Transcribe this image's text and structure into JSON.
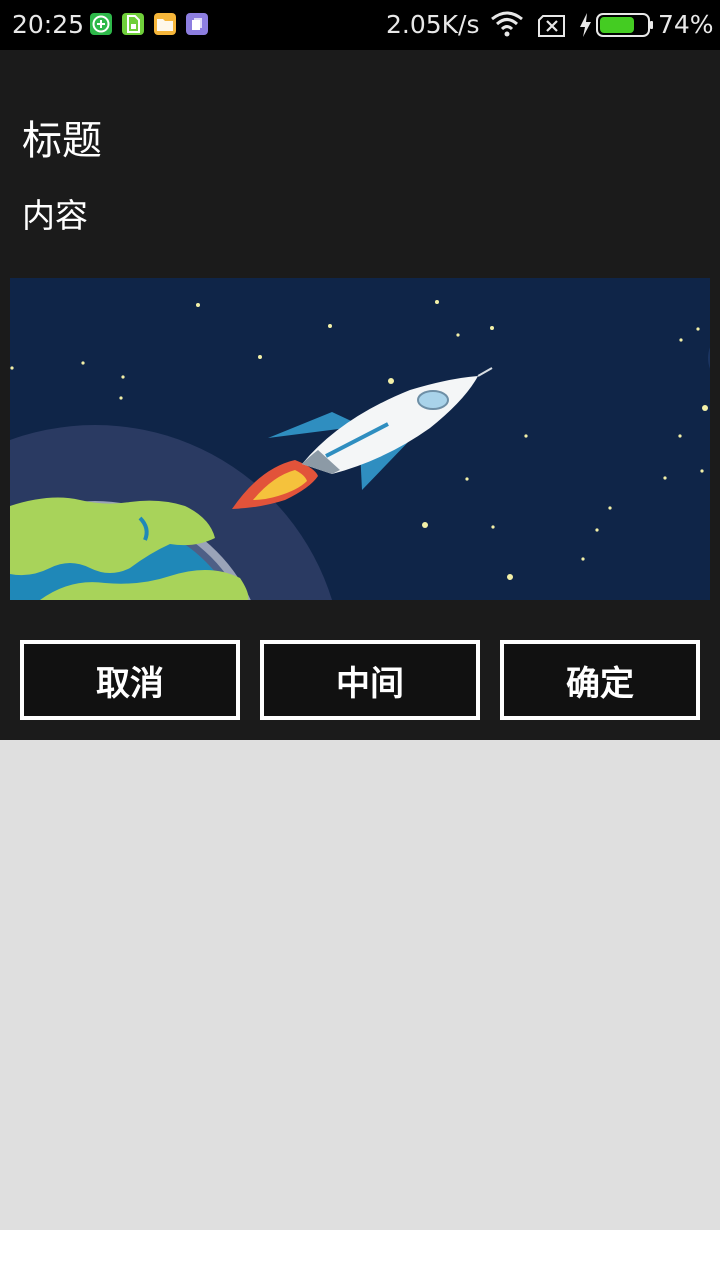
{
  "status_bar": {
    "time": "20:25",
    "network_speed": "2.05K/s",
    "battery_percent": "74%",
    "battery_level": 0.74,
    "notification_icons": [
      "add-app-icon",
      "sim-card-icon",
      "folder-icon",
      "files-icon"
    ],
    "colors": {
      "battery_fill": "#44cc22"
    }
  },
  "dialog": {
    "title": "标题",
    "content": "内容",
    "banner_image": "rocket-earth-illustration",
    "buttons": {
      "cancel": "取消",
      "middle": "中间",
      "confirm": "确定"
    },
    "colors": {
      "background": "#1b1b1b",
      "button_border": "#ffffff",
      "scrim": "#dfdfdf"
    }
  }
}
